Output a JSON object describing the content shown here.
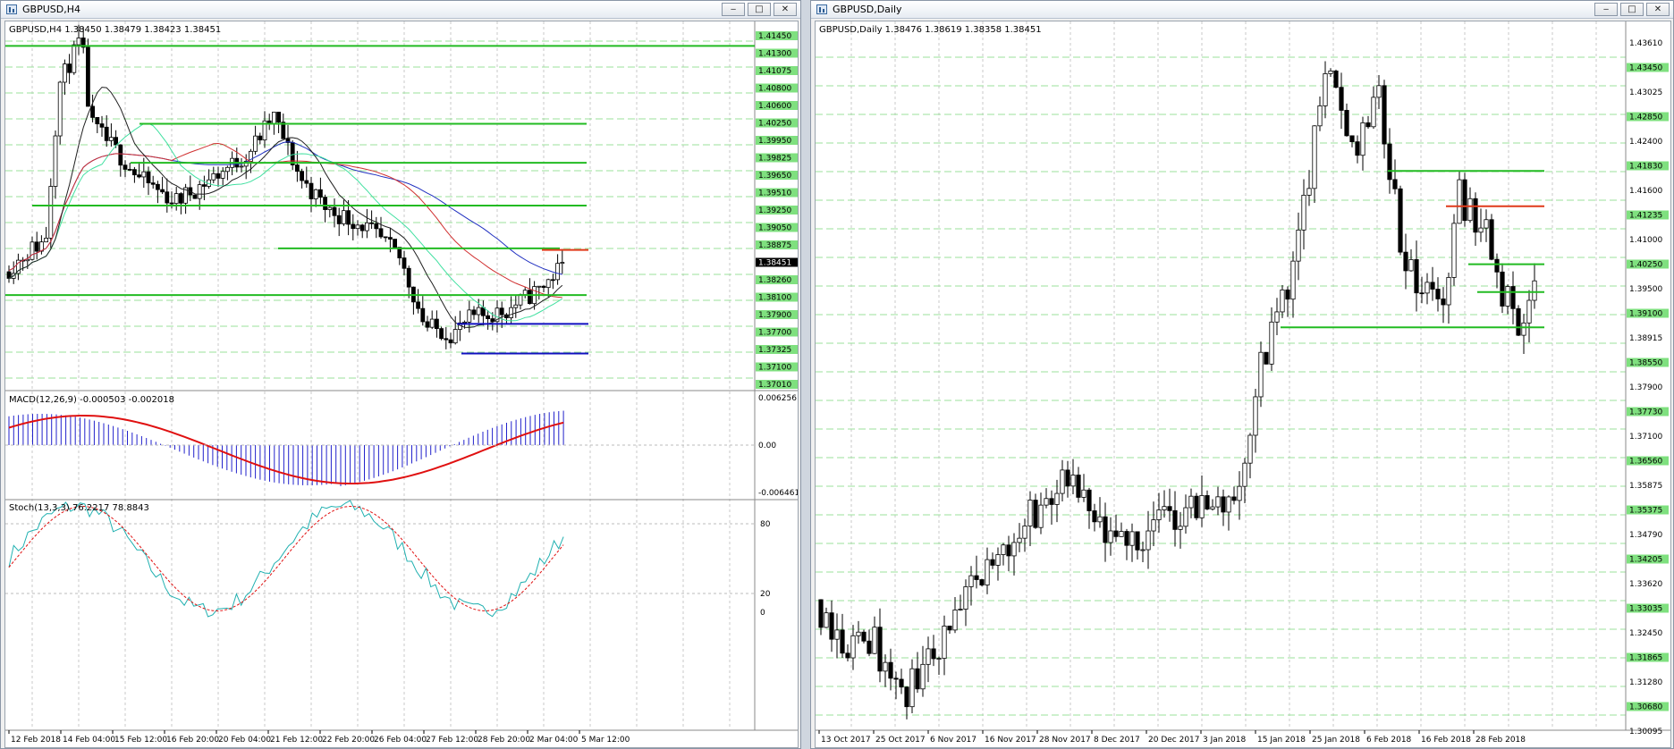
{
  "left_window": {
    "title": "GBPUSD,H4",
    "main": {
      "header": "GBPUSD,H4  1.38450 1.38479 1.38423 1.38451",
      "price_labels": [
        "1.41450",
        "1.41300",
        "1.41075",
        "1.40800",
        "1.40600",
        "1.40250",
        "1.39950",
        "1.39825",
        "1.39650",
        "1.39510",
        "1.39250",
        "1.39050",
        "1.38875",
        "1.38451",
        "1.38260",
        "1.38100",
        "1.37900",
        "1.37700",
        "1.37325",
        "1.37100",
        "1.37010"
      ],
      "current_price": "1.38451"
    },
    "macd": {
      "header": "MACD(12,26,9) -0.000503 -0.002018",
      "scale": [
        "0.006256",
        "0.00",
        "-0.006461"
      ]
    },
    "stoch": {
      "header": "Stoch(13,3,3) 76.2217 78.8843",
      "scale": [
        "80",
        "20",
        "0"
      ]
    },
    "time_labels": [
      "12 Feb 2018",
      "14 Feb 04:00",
      "15 Feb 12:00",
      "16 Feb 20:00",
      "20 Feb 04:00",
      "21 Feb 12:00",
      "22 Feb 20:00",
      "26 Feb 04:00",
      "27 Feb 12:00",
      "28 Feb 20:00",
      "2 Mar 04:00",
      "5 Mar 12:00"
    ]
  },
  "right_window": {
    "title": "GBPUSD,Daily",
    "main": {
      "header": "GBPUSD,Daily  1.38476 1.38619 1.38358 1.38451",
      "price_labels": [
        "1.43610",
        "1.43450",
        "1.43025",
        "1.42850",
        "1.42400",
        "1.41830",
        "1.41600",
        "1.41235",
        "1.41000",
        "1.40250",
        "1.39500",
        "1.39100",
        "1.38915",
        "1.38550",
        "1.37900",
        "1.37730",
        "1.37100",
        "1.36560",
        "1.35875",
        "1.35375",
        "1.34790",
        "1.34205",
        "1.33620",
        "1.33035",
        "1.32450",
        "1.31865",
        "1.31280",
        "1.30680",
        "1.30095"
      ],
      "current_price": "1.38451"
    },
    "time_labels": [
      "13 Oct 2017",
      "25 Oct 2017",
      "6 Nov 2017",
      "16 Nov 2017",
      "28 Nov 2017",
      "8 Dec 2017",
      "20 Dec 2017",
      "3 Jan 2018",
      "15 Jan 2018",
      "25 Jan 2018",
      "6 Feb 2018",
      "16 Feb 2018",
      "28 Feb 2018"
    ]
  },
  "window_buttons": {
    "minimize": "‒",
    "maximize": "□",
    "close": "✕"
  },
  "colors": {
    "bull": "#ffffff",
    "bear": "#000000",
    "support": "#22bb22",
    "resistance_red": "#e03a1a",
    "level_blue": "#1010c0",
    "macd_hist": "#2222cc",
    "macd_signal": "#e01010",
    "stoch_main": "#20b0b0",
    "stoch_signal": "#e01010",
    "level_label": "#7fe07f"
  }
}
